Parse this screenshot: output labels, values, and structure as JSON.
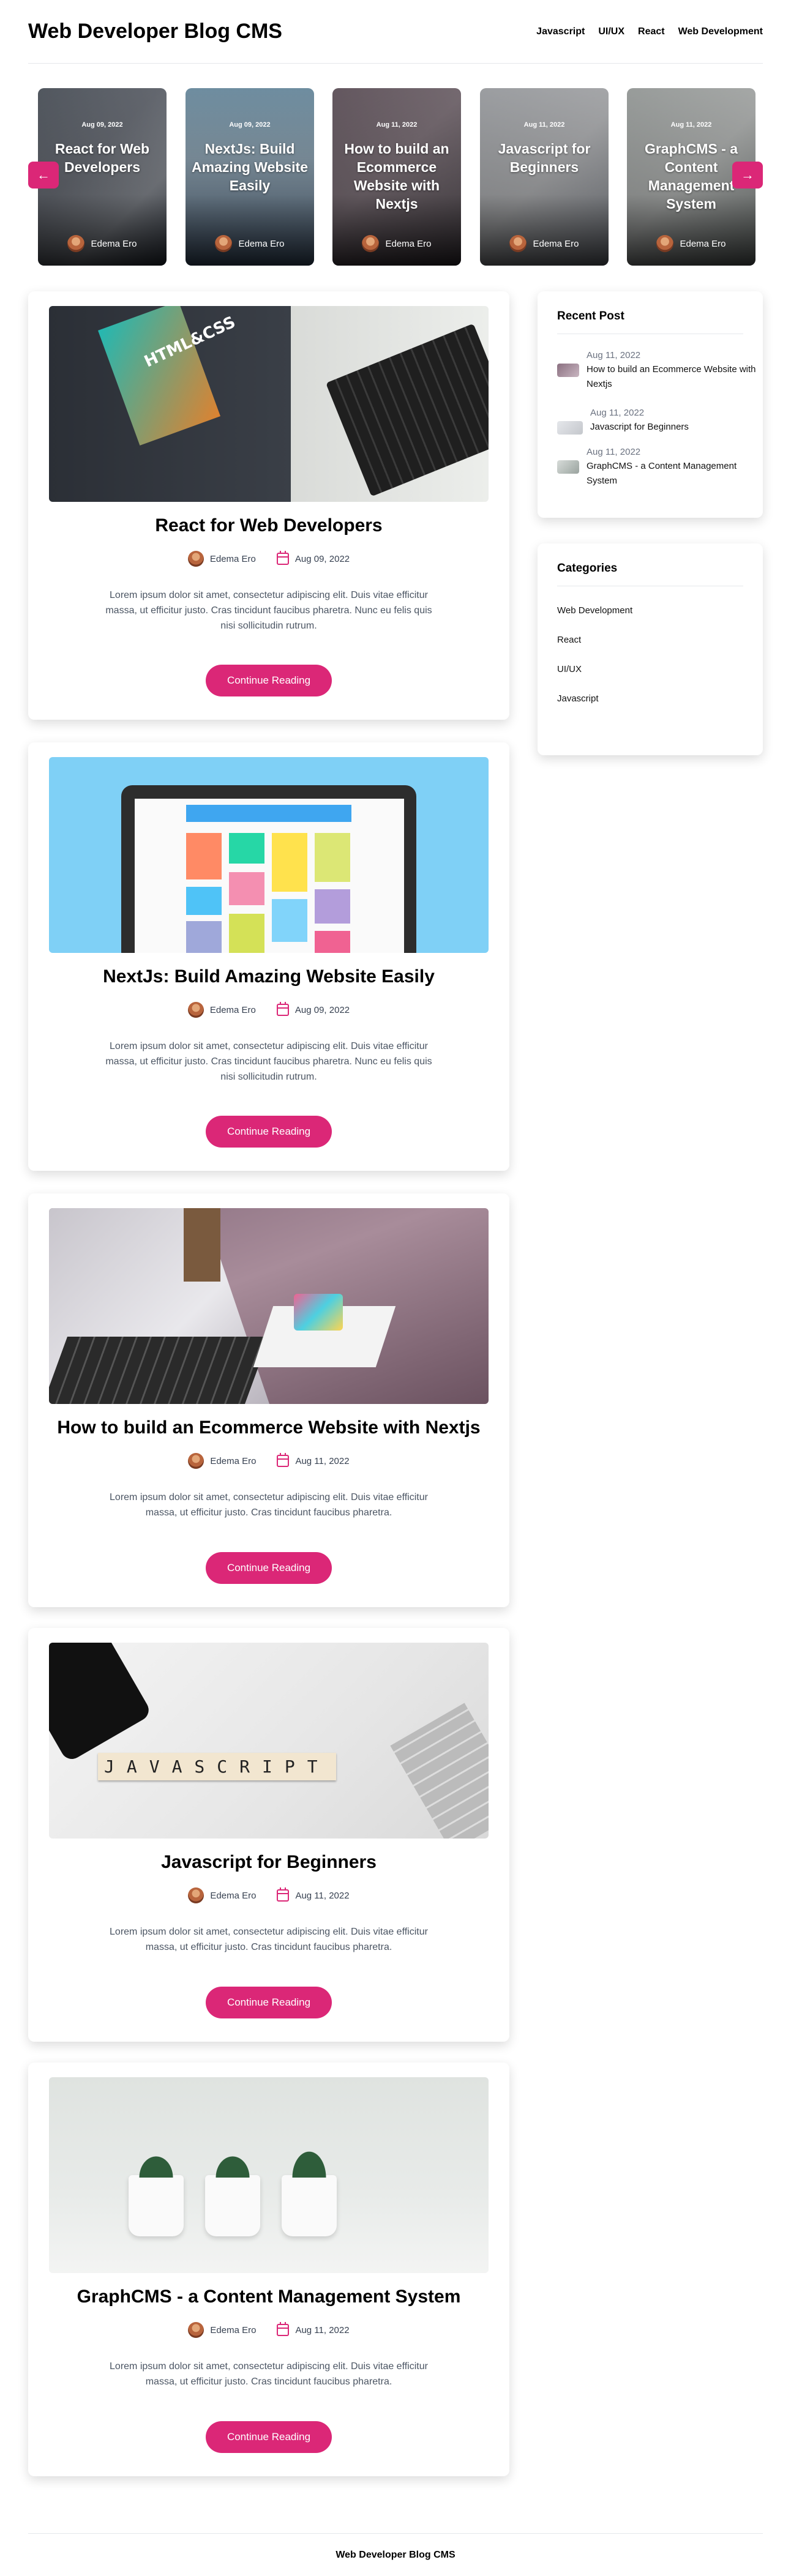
{
  "header": {
    "brand": "Web Developer Blog CMS",
    "nav": [
      "Javascript",
      "UI/UX",
      "React",
      "Web Development"
    ]
  },
  "featured": [
    {
      "date": "Aug 09, 2022",
      "title": "React for Web Developers",
      "author": "Edema Ero"
    },
    {
      "date": "Aug 09, 2022",
      "title": "NextJs: Build Amazing Website Easily",
      "author": "Edema Ero"
    },
    {
      "date": "Aug 11, 2022",
      "title": "How to build an Ecommerce Website with Nextjs",
      "author": "Edema Ero"
    },
    {
      "date": "Aug 11, 2022",
      "title": "Javascript for Beginners",
      "author": "Edema Ero"
    },
    {
      "date": "Aug 11, 2022",
      "title": "GraphCMS - a Content Management System",
      "author": "Edema Ero"
    }
  ],
  "carousel": {
    "prev_icon": "arrow-left-icon",
    "next_icon": "arrow-right-icon",
    "prev_glyph": "←",
    "next_glyph": "→"
  },
  "posts": [
    {
      "title": "React for Web Developers",
      "author": "Edema Ero",
      "date": "Aug 09, 2022",
      "excerpt": "Lorem ipsum dolor sit amet, consectetur adipiscing elit. Duis vitae efficitur massa, ut efficitur justo. Cras tincidunt faucibus pharetra. Nunc eu felis quis nisi sollicitudin rutrum.",
      "button": "Continue Reading"
    },
    {
      "title": "NextJs: Build Amazing Website Easily",
      "author": "Edema Ero",
      "date": "Aug 09, 2022",
      "excerpt": "Lorem ipsum dolor sit amet, consectetur adipiscing elit. Duis vitae efficitur massa, ut efficitur justo. Cras tincidunt faucibus pharetra. Nunc eu felis quis nisi sollicitudin rutrum.",
      "button": "Continue Reading"
    },
    {
      "title": "How to build an Ecommerce Website with Nextjs",
      "author": "Edema Ero",
      "date": "Aug 11, 2022",
      "excerpt": "Lorem ipsum dolor sit amet, consectetur adipiscing elit. Duis vitae efficitur massa, ut efficitur justo. Cras tincidunt faucibus pharetra.",
      "button": "Continue Reading"
    },
    {
      "title": "Javascript for Beginners",
      "author": "Edema Ero",
      "date": "Aug 11, 2022",
      "excerpt": "Lorem ipsum dolor sit amet, consectetur adipiscing elit. Duis vitae efficitur massa, ut efficitur justo. Cras tincidunt faucibus pharetra.",
      "button": "Continue Reading"
    },
    {
      "title": "GraphCMS - a Content Management System",
      "author": "Edema Ero",
      "date": "Aug 11, 2022",
      "excerpt": "Lorem ipsum dolor sit amet, consectetur adipiscing elit. Duis vitae efficitur massa, ut efficitur justo. Cras tincidunt faucibus pharetra.",
      "button": "Continue Reading"
    }
  ],
  "image_text": {
    "html_css": "HTML&CSS",
    "javascript": "JAVASCRIPT"
  },
  "sidebar": {
    "recent": {
      "title": "Recent Post",
      "items": [
        {
          "date": "Aug 11, 2022",
          "title": "How to build an Ecommerce Website with Nextjs"
        },
        {
          "date": "Aug 11, 2022",
          "title": "Javascript for Beginners"
        },
        {
          "date": "Aug 11, 2022",
          "title": "GraphCMS - a Content Management System"
        }
      ]
    },
    "categories": {
      "title": "Categories",
      "items": [
        "Web Development",
        "React",
        "UI/UX",
        "Javascript"
      ]
    }
  },
  "footer": {
    "text": "Web Developer Blog CMS"
  },
  "colors": {
    "accent": "#db2777"
  }
}
